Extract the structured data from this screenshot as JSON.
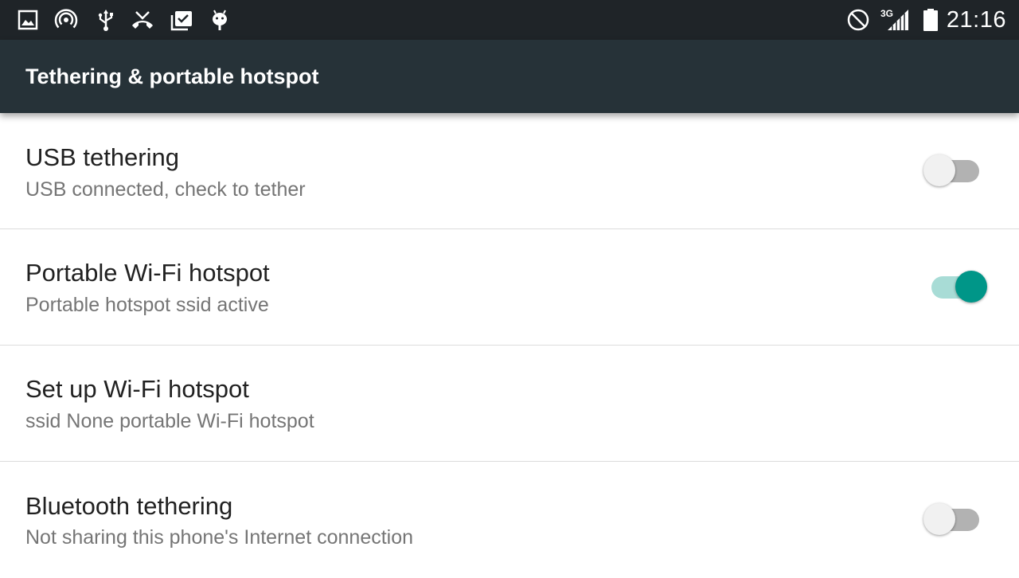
{
  "status_bar": {
    "left_icons": [
      "image-icon",
      "hotspot-icon",
      "usb-icon",
      "missed-call-icon",
      "clipboard-check-icon",
      "android-icon"
    ],
    "right_icons": [
      "do-not-disturb-icon",
      "signal-icon",
      "battery-icon"
    ],
    "network_type": "3G",
    "time": "21:16"
  },
  "app_bar": {
    "title": "Tethering & portable hotspot",
    "color": "#263238"
  },
  "settings": [
    {
      "title": "USB tethering",
      "summary": "USB connected, check to tether",
      "has_switch": true,
      "enabled": false
    },
    {
      "title": "Portable Wi-Fi hotspot",
      "summary": "Portable hotspot ssid active",
      "has_switch": true,
      "enabled": true
    },
    {
      "title": "Set up Wi-Fi hotspot",
      "summary": "ssid None portable Wi-Fi hotspot",
      "has_switch": false
    },
    {
      "title": "Bluetooth tethering",
      "summary": "Not sharing this phone's Internet connection",
      "has_switch": true,
      "enabled": false
    }
  ],
  "accent_color": "#009688"
}
